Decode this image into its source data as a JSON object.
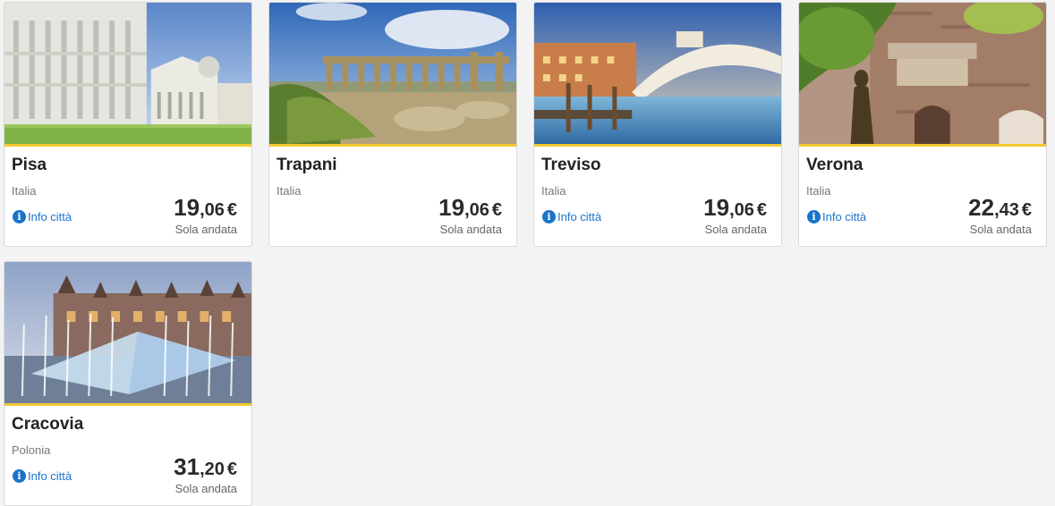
{
  "destinations": [
    {
      "city": "Pisa",
      "country": "Italia",
      "info": "Info città",
      "price_int": "19",
      "price_dec": ",06",
      "currency": "€",
      "trip": "Sola andata",
      "has_info": true
    },
    {
      "city": "Trapani",
      "country": "Italia",
      "info": "",
      "price_int": "19",
      "price_dec": ",06",
      "currency": "€",
      "trip": "Sola andata",
      "has_info": false
    },
    {
      "city": "Treviso",
      "country": "Italia",
      "info": "Info città",
      "price_int": "19",
      "price_dec": ",06",
      "currency": "€",
      "trip": "Sola andata",
      "has_info": true
    },
    {
      "city": "Verona",
      "country": "Italia",
      "info": "Info città",
      "price_int": "22",
      "price_dec": ",43",
      "currency": "€",
      "trip": "Sola andata",
      "has_info": true
    },
    {
      "city": "Cracovia",
      "country": "Polonia",
      "info": "Info città",
      "price_int": "31",
      "price_dec": ",20",
      "currency": "€",
      "trip": "Sola andata",
      "has_info": true
    }
  ],
  "colors": {
    "accent_border": "#f1c933",
    "link": "#1a73c9",
    "background": "#f3f3f3"
  }
}
